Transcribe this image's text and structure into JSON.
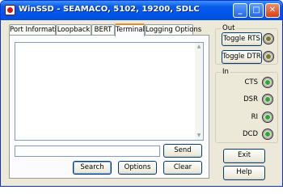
{
  "window": {
    "title": "WinSSD - SEAMACO, 5102, 19200, SDLC",
    "controls": {
      "minimize": "_",
      "maximize": "□",
      "close": "✕"
    }
  },
  "tabs": [
    {
      "label": "Port Information"
    },
    {
      "label": "Loopback"
    },
    {
      "label": "BERT"
    },
    {
      "label": "Terminal",
      "active": true
    },
    {
      "label": "Logging Options"
    }
  ],
  "terminal": {
    "output_text": "",
    "input_value": "",
    "send_label": "Send",
    "search_label": "Search",
    "options_label": "Options",
    "clear_label": "Clear"
  },
  "out_group": {
    "label": "Out",
    "toggle_rts_label": "Toggle RTS",
    "toggle_dtr_label": "Toggle DTR",
    "led_color": "#7a7a2a"
  },
  "in_group": {
    "label": "In",
    "signals": [
      {
        "label": "CTS",
        "led_color": "#2ea82e"
      },
      {
        "label": "DSR",
        "led_color": "#2ea82e"
      },
      {
        "label": "RI",
        "led_color": "#2ea82e"
      },
      {
        "label": "DCD",
        "led_color": "#2ea82e"
      }
    ]
  },
  "buttons": {
    "exit_label": "Exit",
    "help_label": "Help"
  },
  "colors": {
    "titlebar": "#0058ee",
    "window_bg": "#ece9d8",
    "active_tab_accent": "#e68b2c"
  }
}
